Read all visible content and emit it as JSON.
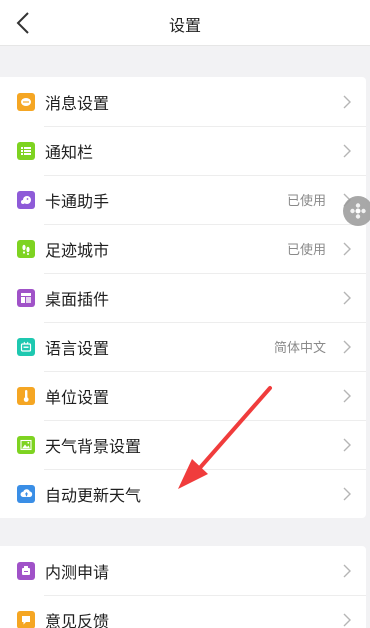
{
  "header": {
    "title": "设置"
  },
  "section1": {
    "items": [
      {
        "label": "消息设置",
        "value": "",
        "icon": "message-icon",
        "color": "#f5a623"
      },
      {
        "label": "通知栏",
        "value": "",
        "icon": "list-icon",
        "color": "#7ed321"
      },
      {
        "label": "卡通助手",
        "value": "已使用",
        "icon": "cartoon-icon",
        "color": "#8e5bd8"
      },
      {
        "label": "足迹城市",
        "value": "已使用",
        "icon": "footprint-icon",
        "color": "#7ed321"
      },
      {
        "label": "桌面插件",
        "value": "",
        "icon": "widget-icon",
        "color": "#a052c8"
      },
      {
        "label": "语言设置",
        "value": "简体中文",
        "icon": "language-icon",
        "color": "#1ec8b0"
      },
      {
        "label": "单位设置",
        "value": "",
        "icon": "thermometer-icon",
        "color": "#f5a623"
      },
      {
        "label": "天气背景设置",
        "value": "",
        "icon": "image-icon",
        "color": "#7ed321"
      },
      {
        "label": "自动更新天气",
        "value": "",
        "icon": "cloud-upload-icon",
        "color": "#3a8ee6"
      }
    ]
  },
  "section2": {
    "items": [
      {
        "label": "内测申请",
        "value": "",
        "icon": "beta-icon",
        "color": "#a052c8"
      },
      {
        "label": "意见反馈",
        "value": "",
        "icon": "feedback-icon",
        "color": "#f5a623"
      }
    ]
  },
  "annotation": {
    "color": "#f03c3c"
  }
}
